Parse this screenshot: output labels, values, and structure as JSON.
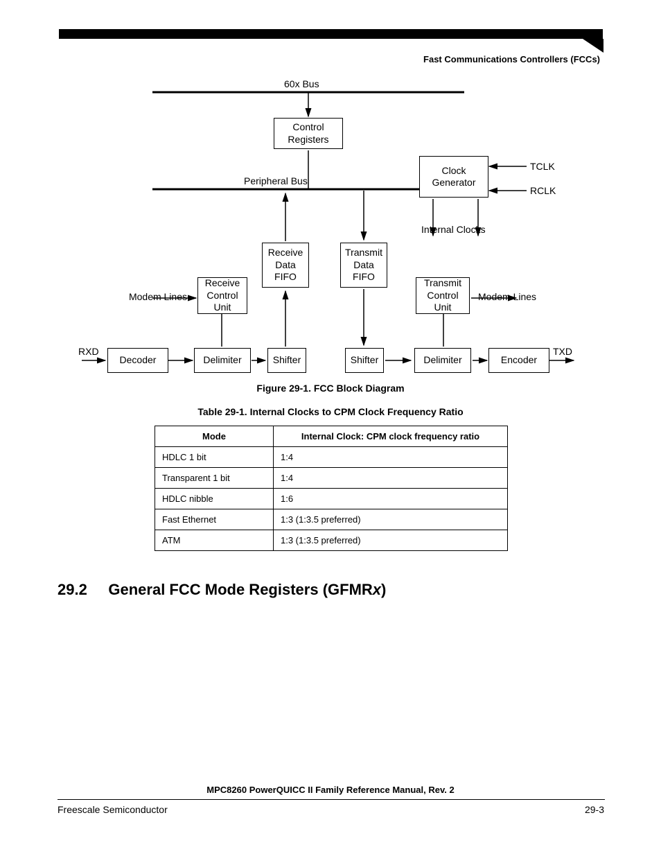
{
  "header": {
    "running": "Fast Communications Controllers (FCCs)"
  },
  "diagram": {
    "labels": {
      "bus60x": "60x Bus",
      "ctrl_regs": "Control\nRegisters",
      "periph_bus": "Peripheral Bus",
      "clk_gen": "Clock\nGenerator",
      "tclk": "TCLK",
      "rclk": "RCLK",
      "int_clks": "Internal Clocks",
      "rcu": "Receive\nControl\nUnit",
      "tcu": "Transmit\nControl\nUnit",
      "rx_fifo": "Receive\nData\nFIFO",
      "tx_fifo": "Transmit\nData\nFIFO",
      "modem_lines_l": "Modem Lines",
      "modem_lines_r": "Modem Lines",
      "rxd": "RXD",
      "txd": "TXD",
      "decoder": "Decoder",
      "delimiter_l": "Delimiter",
      "shifter_l": "Shifter",
      "shifter_r": "Shifter",
      "delimiter_r": "Delimiter",
      "encoder": "Encoder"
    }
  },
  "captions": {
    "figure": "Figure 29-1. FCC Block Diagram",
    "table": "Table 29-1. Internal Clocks to CPM Clock Frequency Ratio"
  },
  "table": {
    "headers": {
      "mode": "Mode",
      "ratio": "Internal Clock: CPM clock frequency ratio"
    },
    "rows": [
      {
        "mode": "HDLC 1 bit",
        "ratio": "1:4"
      },
      {
        "mode": "Transparent 1 bit",
        "ratio": "1:4"
      },
      {
        "mode": "HDLC nibble",
        "ratio": "1:6"
      },
      {
        "mode": "Fast Ethernet",
        "ratio": "1:3 (1:3.5 preferred)"
      },
      {
        "mode": "ATM",
        "ratio": "1:3 (1:3.5 preferred)"
      }
    ]
  },
  "section_heading": {
    "num": "29.2",
    "title_pre": "General FCC Mode Registers (GFMR",
    "title_ital": "x",
    "title_post": ")"
  },
  "footer": {
    "title": "MPC8260 PowerQUICC II Family Reference Manual, Rev. 2",
    "left": "Freescale Semiconductor",
    "right": "29-3"
  }
}
